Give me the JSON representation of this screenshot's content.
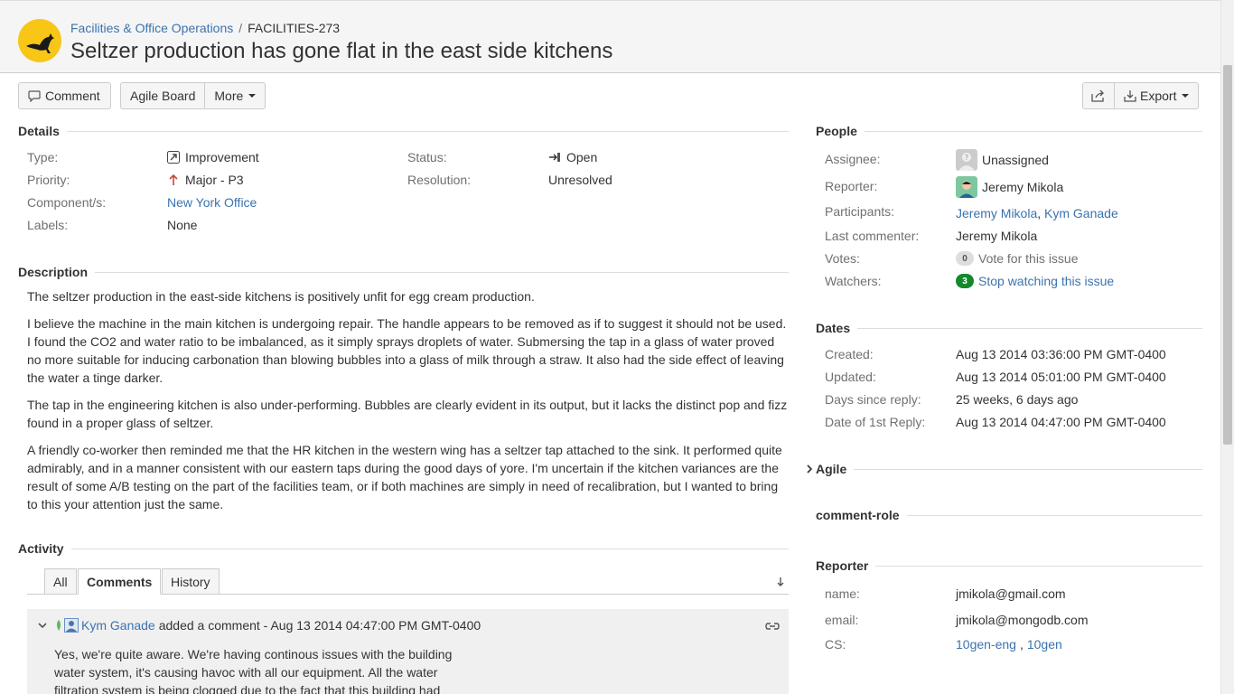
{
  "header": {
    "project": "Facilities & Office Operations",
    "separator": "/",
    "issue_key": "FACILITIES-273",
    "title": "Seltzer production has gone flat in the east side kitchens"
  },
  "toolbar": {
    "comment": "Comment",
    "agile_board": "Agile Board",
    "more": "More",
    "export": "Export"
  },
  "details": {
    "heading": "Details",
    "type_label": "Type:",
    "type_value": "Improvement",
    "priority_label": "Priority:",
    "priority_value": "Major - P3",
    "components_label": "Component/s:",
    "components_value": "New York Office",
    "labels_label": "Labels:",
    "labels_value": "None",
    "status_label": "Status:",
    "status_value": "Open",
    "resolution_label": "Resolution:",
    "resolution_value": "Unresolved"
  },
  "description": {
    "heading": "Description",
    "paragraphs": [
      "The seltzer production in the east-side kitchens is positively unfit for egg cream production.",
      "I believe the machine in the main kitchen is undergoing repair. The handle appears to be removed as if to suggest it should not be used. I found the CO2 and water ratio to be imbalanced, as it simply sprays droplets of water. Submersing the tap in a glass of water proved no more suitable for inducing carbonation than blowing bubbles into a glass of milk through a straw. It also had the side effect of leaving the water a tinge darker.",
      "The tap in the engineering kitchen is also under-performing. Bubbles are clearly evident in its output, but it lacks the distinct pop and fizz found in a proper glass of seltzer.",
      "A friendly co-worker then reminded me that the HR kitchen in the western wing has a seltzer tap attached to the sink. It performed quite admirably, and in a manner consistent with our eastern taps during the good days of yore. I'm uncertain if the kitchen variances are the result of some A/B testing on the part of the facilities team, or if both machines are simply in need of recalibration, but I wanted to bring to this your attention just the same."
    ]
  },
  "activity": {
    "heading": "Activity",
    "tabs": [
      "All",
      "Comments",
      "History"
    ],
    "comment": {
      "author": "Kym Ganade",
      "action": "added a comment - Aug 13 2014 04:47:00 PM GMT-0400",
      "body": "Yes, we're quite aware. We're having continous issues with the building water system, it's causing havoc with all our equipment. All the water filtration system is being clogged due to the fact that this building had"
    }
  },
  "people": {
    "heading": "People",
    "assignee_label": "Assignee:",
    "assignee_value": "Unassigned",
    "reporter_label": "Reporter:",
    "reporter_value": "Jeremy Mikola",
    "participants_label": "Participants:",
    "participant_1": "Jeremy Mikola",
    "participant_2": "Kym Ganade",
    "last_commenter_label": "Last commenter:",
    "last_commenter_value": "Jeremy Mikola",
    "votes_label": "Votes:",
    "votes_count": "0",
    "votes_text": "Vote for this issue",
    "watchers_label": "Watchers:",
    "watchers_count": "3",
    "watchers_text": "Stop watching this issue"
  },
  "dates": {
    "heading": "Dates",
    "created_label": "Created:",
    "created_value": "Aug 13 2014 03:36:00 PM GMT-0400",
    "updated_label": "Updated:",
    "updated_value": "Aug 13 2014 05:01:00 PM GMT-0400",
    "days_label": "Days since reply:",
    "days_value": "25 weeks, 6 days ago",
    "first_reply_label": "Date of 1st Reply:",
    "first_reply_value": "Aug 13 2014 04:47:00 PM GMT-0400"
  },
  "agile": {
    "heading": "Agile"
  },
  "comment_role": {
    "heading": "comment-role"
  },
  "reporter_panel": {
    "heading": "Reporter",
    "name_label": "name:",
    "name_value": "jmikola@gmail.com",
    "email_label": "email:",
    "email_value": "jmikola@mongodb.com",
    "cs_label": "CS:",
    "cs_1": "10gen-eng",
    "cs_sep": ",",
    "cs_2": "10gen"
  },
  "colors": {
    "link": "#3b73af",
    "logo_bg": "#f7c616",
    "watch_badge": "#14892c"
  }
}
